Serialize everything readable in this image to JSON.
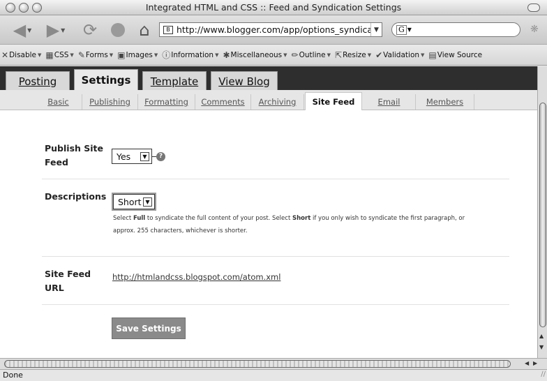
{
  "window": {
    "title": "Integrated HTML and CSS :: Feed and Syndication Settings"
  },
  "navbar": {
    "url": "http://www.blogger.com/app/options_syndicati",
    "search_text": "G"
  },
  "devbar": {
    "items": [
      {
        "label": "Disable",
        "icon": "x-icon"
      },
      {
        "label": "CSS",
        "icon": "css-icon"
      },
      {
        "label": "Forms",
        "icon": "forms-icon"
      },
      {
        "label": "Images",
        "icon": "images-icon"
      },
      {
        "label": "Information",
        "icon": "information-icon"
      },
      {
        "label": "Miscellaneous",
        "icon": "miscellaneous-icon"
      },
      {
        "label": "Outline",
        "icon": "outline-icon"
      },
      {
        "label": "Resize",
        "icon": "resize-icon"
      },
      {
        "label": "Validation",
        "icon": "validation-icon"
      },
      {
        "label": "View Source",
        "icon": "view-source-icon"
      }
    ]
  },
  "tabs": [
    {
      "label": "Posting"
    },
    {
      "label": "Settings",
      "active": true
    },
    {
      "label": "Template"
    },
    {
      "label": "View Blog"
    }
  ],
  "subtabs": [
    {
      "label": "Basic"
    },
    {
      "label": "Publishing"
    },
    {
      "label": "Formatting"
    },
    {
      "label": "Comments"
    },
    {
      "label": "Archiving"
    },
    {
      "label": "Site Feed",
      "active": true
    },
    {
      "label": "Email"
    },
    {
      "label": "Members"
    }
  ],
  "form": {
    "publish": {
      "label_line1": "Publish Site",
      "label_line2": "Feed",
      "value": "Yes",
      "help": "?"
    },
    "descriptions": {
      "label": "Descriptions",
      "value": "Short",
      "hint_part1": "Select ",
      "hint_bold1": "Full",
      "hint_part2": " to syndicate the full content of your post. Select ",
      "hint_bold2": "Short",
      "hint_part3": " if you only wish to syndicate the first paragraph, or",
      "hint_line2": "approx. 255 characters, whichever is shorter."
    },
    "feed_url": {
      "label_line1": "Site Feed",
      "label_line2": "URL",
      "value": "http://htmlandcss.blogspot.com/atom.xml"
    },
    "save_label": "Save Settings"
  },
  "status": {
    "text": "Done"
  },
  "colors": {
    "tabstrip": "#2e2e2e",
    "save_button": "#8a8a8a"
  }
}
